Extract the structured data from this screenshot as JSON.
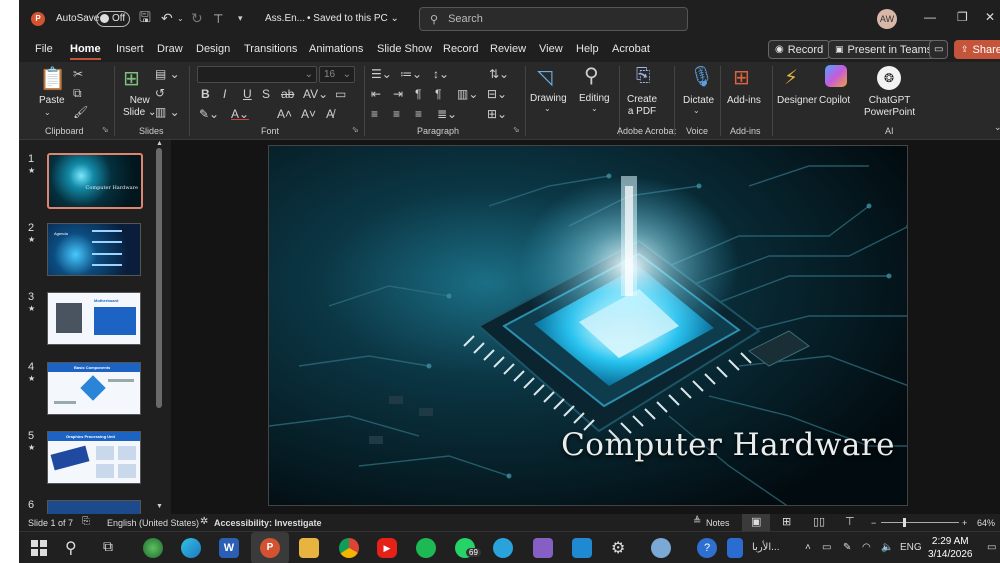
{
  "titlebar": {
    "autosave_label": "AutoSave",
    "autosave_state": "Off",
    "filename": "Ass.En...",
    "save_status": "Saved to this PC",
    "search_placeholder": "Search",
    "avatar_initials": "AW"
  },
  "menu": {
    "tabs": [
      "File",
      "Home",
      "Insert",
      "Draw",
      "Design",
      "Transitions",
      "Animations",
      "Slide Show",
      "Record",
      "Review",
      "View",
      "Help",
      "Acrobat"
    ],
    "active_tab": "Home",
    "record_label": "Record",
    "teams_label": "Present in Teams",
    "share_label": "Share"
  },
  "ribbon": {
    "paste_label": "Paste",
    "clipboard_group": "Clipboard",
    "new_slide_label_1": "New",
    "new_slide_label_2": "Slide",
    "slides_group": "Slides",
    "font_size": "16",
    "font_group": "Font",
    "paragraph_group": "Paragraph",
    "drawing_label": "Drawing",
    "editing_label": "Editing",
    "create_pdf_1": "Create",
    "create_pdf_2": "a PDF",
    "acrobat_group": "Adobe Acrobat",
    "dictate_label": "Dictate",
    "voice_group": "Voice",
    "addins_label": "Add-ins",
    "addins_group": "Add-ins",
    "designer_label": "Designer",
    "copilot_label": "Copilot",
    "chatgpt_1": "ChatGPT",
    "chatgpt_2": "PowerPoint",
    "ai_group": "AI"
  },
  "thumbnails": [
    {
      "num": "1",
      "title": "Computer Hardware"
    },
    {
      "num": "2",
      "title": "Agenda"
    },
    {
      "num": "3",
      "title": "Motherboard"
    },
    {
      "num": "4",
      "title": "Basic Components"
    },
    {
      "num": "5",
      "title": "Graphics Processing Unit"
    },
    {
      "num": "6",
      "title": ""
    }
  ],
  "slide": {
    "title": "Computer Hardware"
  },
  "status": {
    "slide_info": "Slide 1 of 7",
    "language": "English (United States)",
    "accessibility": "Accessibility: Investigate",
    "notes_label": "Notes",
    "zoom": "64%"
  },
  "taskbar": {
    "badge_count": "69",
    "tray_text": "الأربا...",
    "input_lang": "ENG",
    "time": "2:29 AM",
    "date": "3/14/2026"
  },
  "colors": {
    "accent": "#c4553b",
    "app_bg": "#1f1f1f",
    "ribbon_bg": "#292929"
  }
}
